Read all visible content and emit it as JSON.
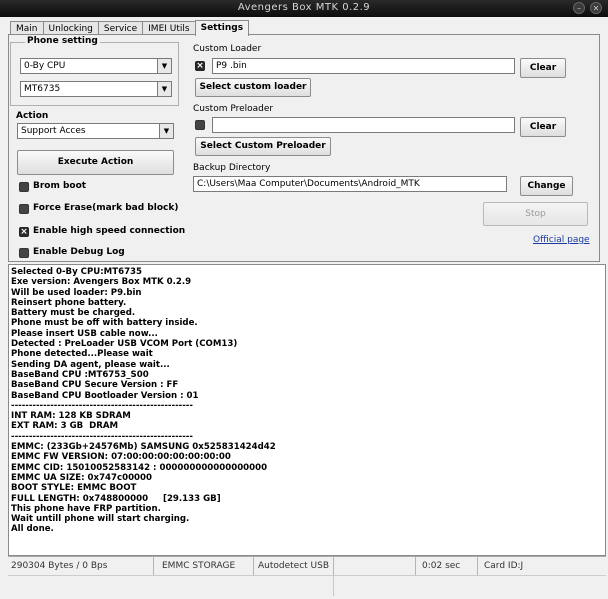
{
  "window": {
    "title": "Avengers Box MTK 0.2.9"
  },
  "tabs": [
    {
      "label": "Main",
      "active": false
    },
    {
      "label": "Unlocking",
      "active": false
    },
    {
      "label": "Service",
      "active": false
    },
    {
      "label": "IMEI Utils",
      "active": false
    },
    {
      "label": "Settings",
      "active": true
    }
  ],
  "phone_setting": {
    "legend": "Phone setting",
    "cpu_select": "0-By CPU",
    "model_select": "MT6735"
  },
  "action": {
    "label": "Action",
    "select": "Support Acces",
    "execute_label": "Execute Action"
  },
  "options": [
    {
      "label": "Brom boot",
      "checked": false
    },
    {
      "label": "Force Erase(mark bad block)",
      "checked": false
    },
    {
      "label": "Enable high speed connection",
      "checked": true
    },
    {
      "label": "Enable Debug Log",
      "checked": false
    }
  ],
  "custom_loader": {
    "label": "Custom Loader",
    "checked": true,
    "value": "P9 .bin",
    "clear_label": "Clear",
    "select_label": "Select custom loader"
  },
  "custom_preloader": {
    "label": "Custom Preloader",
    "checked": false,
    "value": "",
    "clear_label": "Clear",
    "select_label": "Select Custom Preloader"
  },
  "backup": {
    "label": "Backup Directory",
    "value": "C:\\Users\\Maa Computer\\Documents\\Android_MTK",
    "change_label": "Change"
  },
  "stop_label": "Stop",
  "official_link": "Official page",
  "log_lines": [
    "Selected 0-By CPU:MT6735",
    "Exe version: Avengers Box MTK 0.2.9",
    "Will be used loader: P9.bin",
    "Reinsert phone battery.",
    "Battery must be charged.",
    "Phone must be off with battery inside.",
    "Please insert USB cable now...",
    "Detected : PreLoader USB VCOM Port (COM13)",
    "Phone detected...Please wait",
    "Sending DA agent, please wait...",
    "BaseBand CPU :MT6753_S00",
    "BaseBand CPU Secure Version : FF",
    "BaseBand CPU Bootloader Version : 01",
    "---------------------------------------------------",
    "INT RAM: 128 KB SDRAM",
    "EXT RAM: 3 GB  DRAM",
    "---------------------------------------------------",
    "EMMC: (233Gb+24576Mb) SAMSUNG 0x525831424d42",
    "EMMC FW VERSION: 07:00:00:00:00:00:00:00",
    "EMMC CID: 15010052583142 : 000000000000000000",
    "EMMC UA SIZE: 0x747c00000",
    "BOOT STYLE: EMMC BOOT",
    "FULL LENGTH: 0x748800000     [29.133 GB]",
    "This phone have FRP partition.",
    "Wait untill phone will start charging.",
    "All done."
  ],
  "status": {
    "bytes": "290304 Bytes / 0 Bps",
    "storage": "EMMC STORAGE",
    "usb": "Autodetect USB",
    "time": "0:02 sec",
    "card": "Card ID:J"
  }
}
